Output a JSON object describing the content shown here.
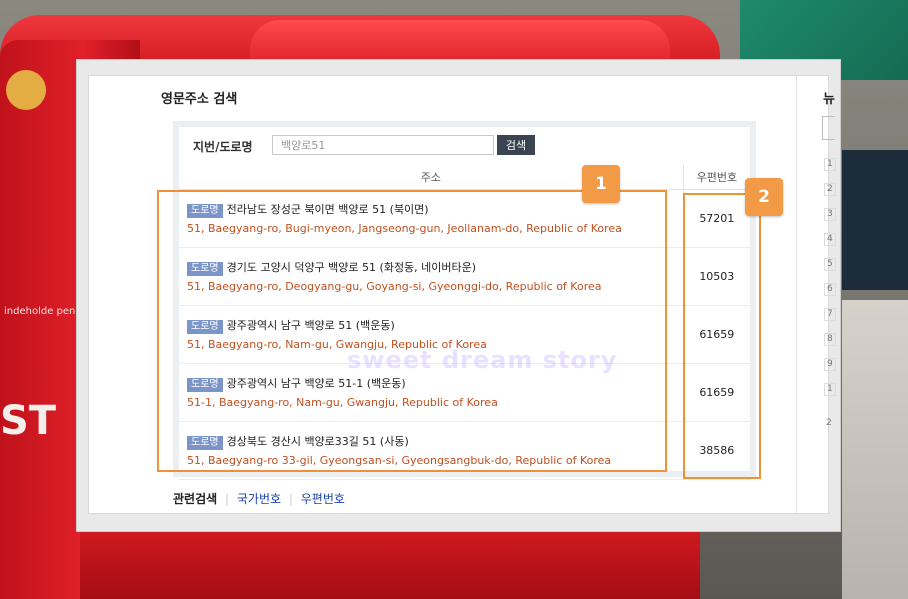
{
  "page": {
    "title": "영문주소 검색",
    "watermark": "sweet dream story"
  },
  "search": {
    "label": "지번/도로명",
    "value": "백양로51",
    "button": "검색"
  },
  "table": {
    "headers": {
      "address": "주소",
      "zipcode": "우편번호"
    },
    "rows": [
      {
        "tag": "도로명",
        "korean": "전라남도 장성군 북이면 백양로 51 (북이면)",
        "english": "51, Baegyang-ro, Bugi-myeon, Jangseong-gun, Jeollanam-do, Republic of Korea",
        "zip": "57201"
      },
      {
        "tag": "도로명",
        "korean": "경기도 고양시 덕양구 백양로 51 (화정동, 네이버타운)",
        "english": "51, Baegyang-ro, Deogyang-gu, Goyang-si, Gyeonggi-do, Republic of Korea",
        "zip": "10503"
      },
      {
        "tag": "도로명",
        "korean": "광주광역시 남구 백양로 51 (백운동)",
        "english": "51, Baegyang-ro, Nam-gu, Gwangju, Republic of Korea",
        "zip": "61659"
      },
      {
        "tag": "도로명",
        "korean": "광주광역시 남구 백양로 51-1 (백운동)",
        "english": "51-1, Baegyang-ro, Nam-gu, Gwangju, Republic of Korea",
        "zip": "61659"
      },
      {
        "tag": "도로명",
        "korean": "경상북도 경산시 백양로33길 51 (사동)",
        "english": "51, Baegyang-ro 33-gil, Gyeongsan-si, Gyeongsangbuk-do, Republic of Korea",
        "zip": "38586"
      }
    ]
  },
  "related": {
    "label": "관련검색",
    "links": [
      "국가번호",
      "우편번호"
    ]
  },
  "annotations": {
    "badge1": "1",
    "badge2": "2",
    "color": "#f0913a"
  },
  "sidebar": {
    "head": "뉴",
    "numbers": [
      "1",
      "2",
      "3",
      "4",
      "5",
      "6",
      "7",
      "8",
      "9",
      "1"
    ],
    "footer": "2"
  },
  "background": {
    "stamp_text": "indeholde pen",
    "letters": "ST"
  }
}
